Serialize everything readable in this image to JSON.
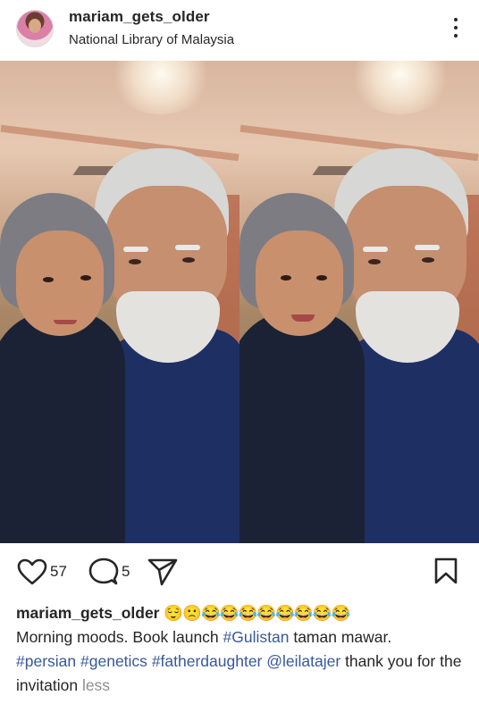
{
  "post": {
    "username": "mariam_gets_older",
    "location": "National Library of Malaysia"
  },
  "actions": {
    "likes": "57",
    "comments": "5"
  },
  "caption": {
    "username": "mariam_gets_older",
    "emojis": "😌🙁😂😂😂😂😂😂😂😂",
    "text1": "Morning moods. Book launch ",
    "hashtag_gulistan": "#Gulistan",
    "text2": " taman mawar.",
    "hashtag_persian": "#persian",
    "hashtag_genetics": "#genetics",
    "hashtag_fatherdaughter": "#fatherdaughter",
    "mention": "@leilatajer",
    "text3": " thank you for the invitation ",
    "less": "less"
  },
  "icons": {
    "like": "heart-icon",
    "comment": "comment-icon",
    "share": "send-icon",
    "save": "bookmark-icon",
    "more": "more-options-icon"
  },
  "colors": {
    "link": "#385898",
    "muted": "#8e8e8e",
    "text": "#262626"
  }
}
